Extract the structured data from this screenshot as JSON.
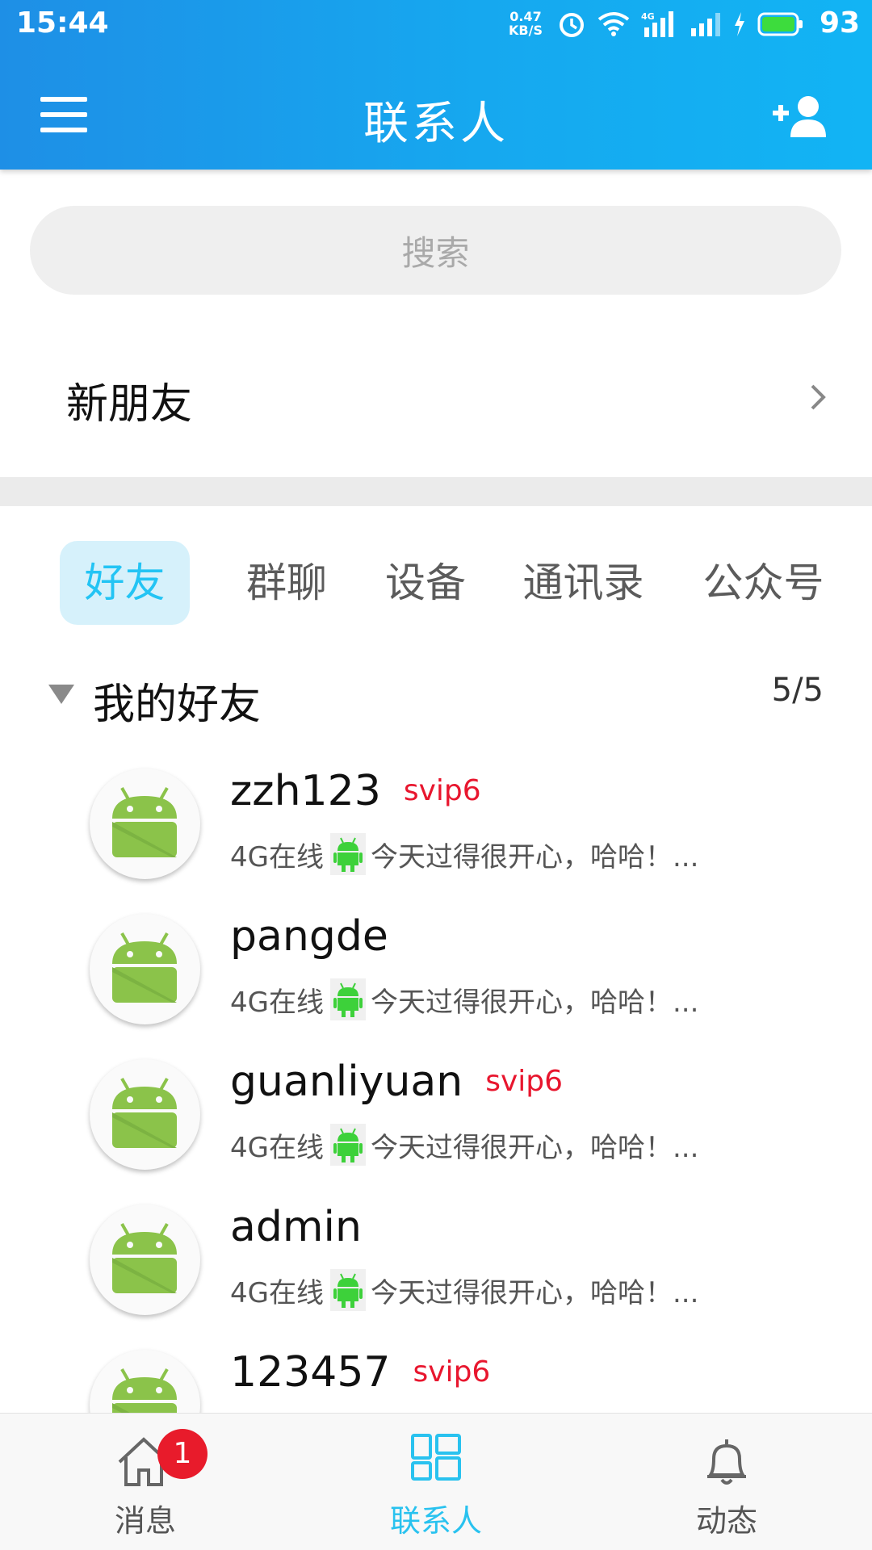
{
  "status_bar": {
    "time": "15:44",
    "net_speed_value": "0.47",
    "net_speed_unit": "KB/S",
    "network_label": "4G",
    "battery_percent": "93",
    "icons": [
      "alarm-icon",
      "wifi-icon",
      "signal-4g-icon",
      "signal-icon",
      "charging-icon",
      "battery-icon"
    ]
  },
  "header": {
    "title": "联系人",
    "left_icon": "menu-icon",
    "right_icon": "add-friend-icon"
  },
  "search": {
    "placeholder": "搜索"
  },
  "new_friends": {
    "label": "新朋友"
  },
  "tabs": [
    {
      "label": "好友",
      "active": true
    },
    {
      "label": "群聊",
      "active": false
    },
    {
      "label": "设备",
      "active": false
    },
    {
      "label": "通讯录",
      "active": false
    },
    {
      "label": "公众号",
      "active": false
    }
  ],
  "group": {
    "name": "我的好友",
    "count": "5/5",
    "expanded": true
  },
  "contacts": [
    {
      "name": "zzh123",
      "vip": "svip6",
      "network": "4G在线",
      "signature": "今天过得很开心，哈哈！..."
    },
    {
      "name": "pangde",
      "vip": "",
      "network": "4G在线",
      "signature": "今天过得很开心，哈哈！..."
    },
    {
      "name": "guanliyuan",
      "vip": "svip6",
      "network": "4G在线",
      "signature": "今天过得很开心，哈哈！..."
    },
    {
      "name": "admin",
      "vip": "",
      "network": "4G在线",
      "signature": "今天过得很开心，哈哈！..."
    },
    {
      "name": "123457",
      "vip": "svip6",
      "network": "",
      "signature": ""
    }
  ],
  "bottom_nav": [
    {
      "label": "消息",
      "icon": "home-icon",
      "badge": "1",
      "active": false
    },
    {
      "label": "联系人",
      "icon": "contacts-grid-icon",
      "active": true
    },
    {
      "label": "动态",
      "icon": "bell-icon",
      "active": false
    }
  ],
  "colors": {
    "header_gradient_start": "#1e8fe6",
    "header_gradient_end": "#12b4f4",
    "accent": "#23c4f4",
    "vip_red": "#e8162e",
    "android_green": "#8bc34a"
  }
}
